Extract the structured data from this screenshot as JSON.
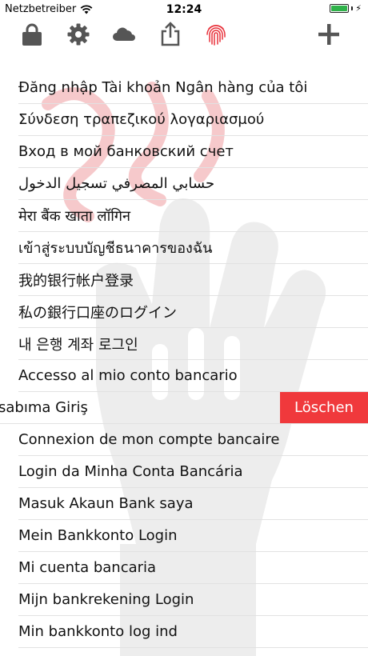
{
  "status": {
    "carrier": "Netzbetreiber",
    "time": "12:24",
    "battery_level": 1.0
  },
  "toolbar": {
    "icons": [
      "lock-icon",
      "gear-icon",
      "cloud-icon",
      "share-icon",
      "fingerprint-icon",
      "plus-icon"
    ],
    "accent_color": "#e8313a",
    "icon_color": "#555555"
  },
  "list": {
    "items": [
      "Đăng nhập Tài khoản Ngân hàng của tôi",
      "Σύνδεση τραπεζικού λογαριασμού",
      "Вход в мой банковский счет",
      "حسابي المصرفي تسجيل الدخول",
      "मेरा बैंक खाता लॉगिन",
      "เข้าสู่ระบบบัญชีธนาคารของฉัน",
      "我的银行帐户登录",
      "私の銀行口座のログイン",
      "내 은행 계좌 로그인",
      "Accesso al mio conto bancario",
      "sabıma Giriş",
      "Connexion de mon compte bancaire",
      "Login da Minha Conta Bancária",
      "Masuk Akaun Bank saya",
      "Mein Bankkonto Login",
      "Mi cuenta bancaria",
      "Mijn bankrekening Login",
      "Min bankkonto log ind"
    ],
    "delete_label": "Löschen",
    "delete_color": "#f0393c"
  }
}
